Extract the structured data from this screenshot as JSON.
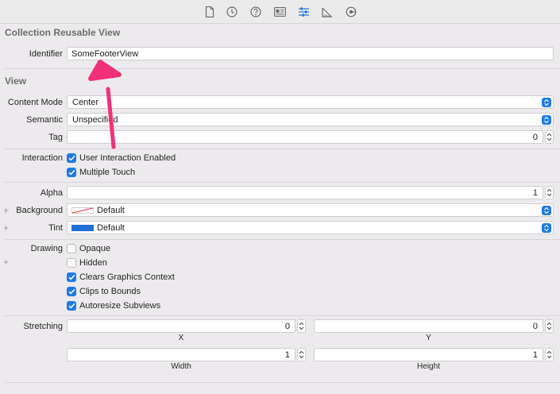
{
  "toolbar": {
    "icons": [
      "file-icon",
      "history-icon",
      "help-icon",
      "identity-icon",
      "attributes-icon",
      "size-icon",
      "connections-icon"
    ]
  },
  "collection_section": {
    "title": "Collection Reusable View",
    "identifier_label": "Identifier",
    "identifier_value": "SomeFooterView"
  },
  "view_section": {
    "title": "View",
    "content_mode_label": "Content Mode",
    "content_mode_value": "Center",
    "semantic_label": "Semantic",
    "semantic_value": "Unspecified",
    "tag_label": "Tag",
    "tag_value": "0",
    "interaction_label": "Interaction",
    "user_interaction_label": "User Interaction Enabled",
    "user_interaction_checked": true,
    "multiple_touch_label": "Multiple Touch",
    "multiple_touch_checked": true,
    "alpha_label": "Alpha",
    "alpha_value": "1",
    "background_label": "Background",
    "background_value": "Default",
    "tint_label": "Tint",
    "tint_value": "Default",
    "tint_color": "#1f6fd6",
    "drawing_label": "Drawing",
    "opaque_label": "Opaque",
    "opaque_checked": false,
    "hidden_label": "Hidden",
    "hidden_checked": false,
    "clears_label": "Clears Graphics Context",
    "clears_checked": true,
    "clips_label": "Clips to Bounds",
    "clips_checked": true,
    "autoresize_label": "Autoresize Subviews",
    "autoresize_checked": true,
    "stretching_label": "Stretching",
    "stretch_x_value": "0",
    "stretch_x_caption": "X",
    "stretch_y_value": "0",
    "stretch_y_caption": "Y",
    "stretch_w_value": "1",
    "stretch_w_caption": "Width",
    "stretch_h_value": "1",
    "stretch_h_caption": "Height"
  },
  "colors": {
    "accent": "#1f7ae6",
    "annotation_arrow": "#f0317a"
  }
}
